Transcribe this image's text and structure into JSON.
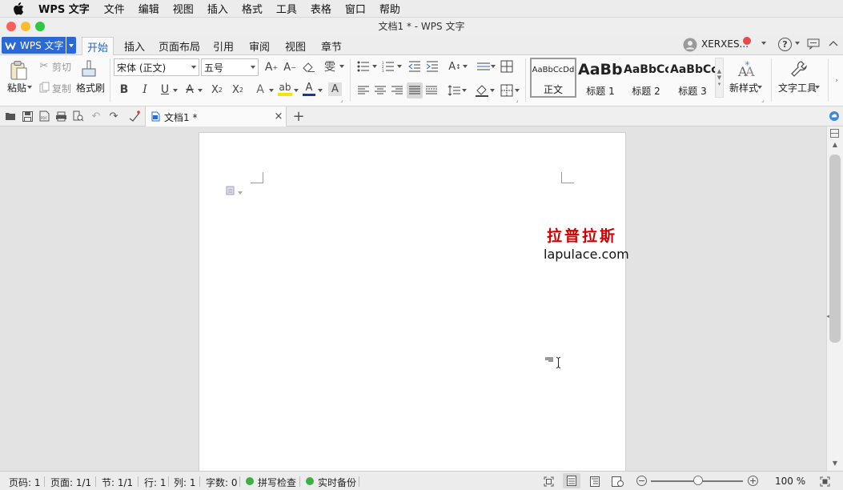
{
  "menubar": {
    "app": "WPS 文字",
    "items": [
      "文件",
      "编辑",
      "视图",
      "插入",
      "格式",
      "工具",
      "表格",
      "窗口",
      "帮助"
    ]
  },
  "window": {
    "title": "文档1 * - WPS 文字"
  },
  "tabs": {
    "wps_button": "WPS 文字",
    "items": [
      "开始",
      "插入",
      "页面布局",
      "引用",
      "审阅",
      "视图",
      "章节"
    ],
    "active": 0,
    "user": "XERXES...",
    "help": "?"
  },
  "ribbon": {
    "paste": "粘贴",
    "cut": "剪切",
    "copy": "复制",
    "format_painter": "格式刷",
    "font_name": "宋体 (正文)",
    "font_size": "五号",
    "phonetic": "雯",
    "styles": [
      {
        "preview": "AaBbCcDd",
        "name": "正文"
      },
      {
        "preview": "AaBb",
        "name": "标题 1"
      },
      {
        "preview": "AaBbCc",
        "name": "标题 2"
      },
      {
        "preview": "AaBbCc",
        "name": "标题 3"
      }
    ],
    "new_style": "新样式",
    "text_tools": "文字工具"
  },
  "doc_tabs": {
    "current": "文档1 *"
  },
  "document": {
    "watermark_cn": "拉普拉斯",
    "watermark_en": "lapulace.com"
  },
  "status": {
    "page_no": "页码: 1",
    "pages": "页面: 1/1",
    "section": "节: 1/1",
    "row": "行: 1",
    "col": "列: 1",
    "words": "字数: 0",
    "spell_check": "拼写检查",
    "backup": "实时备份",
    "zoom": "100 %"
  },
  "colors": {
    "accent": "#2b6ad6",
    "watermark": "#d40000",
    "status_green": "#3cb043"
  }
}
